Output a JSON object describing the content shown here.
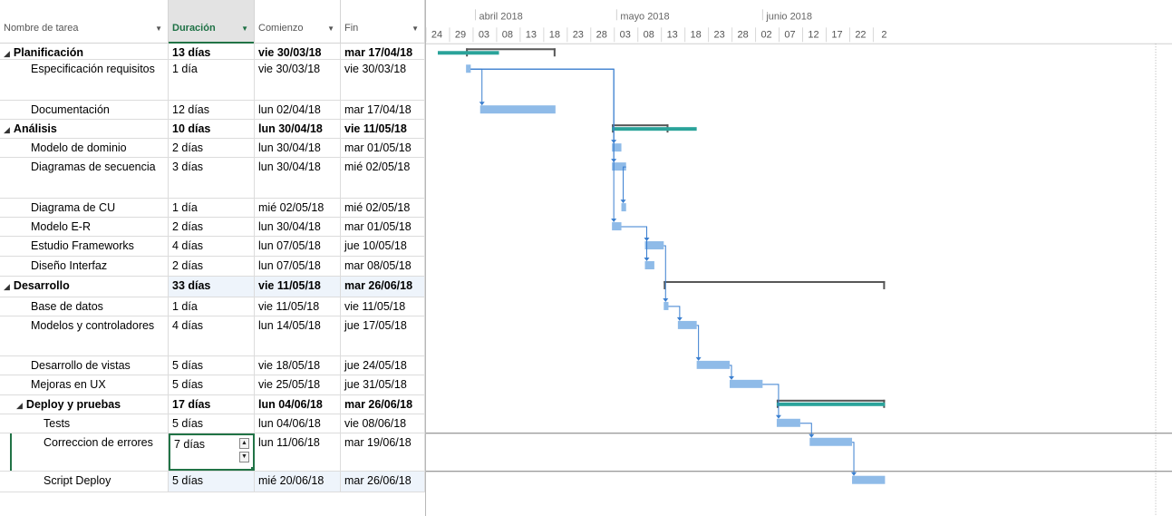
{
  "table": {
    "headers": {
      "name": "Nombre de tarea",
      "duration": "Duración",
      "start": "Comienzo",
      "end": "Fin"
    },
    "tasks": [
      {
        "name": "Planificación",
        "duration": "13 días",
        "start": "vie 30/03/18",
        "end": "mar 17/04/18",
        "summary": true,
        "level": 0
      },
      {
        "name": "Especificación requisitos",
        "duration": "1 día",
        "start": "vie 30/03/18",
        "end": "vie 30/03/18",
        "summary": false,
        "level": 1
      },
      {
        "name": "Documentación",
        "duration": "12 días",
        "start": "lun 02/04/18",
        "end": "mar 17/04/18",
        "summary": false,
        "level": 1
      },
      {
        "name": "Análisis",
        "duration": "10 días",
        "start": "lun 30/04/18",
        "end": "vie 11/05/18",
        "summary": true,
        "level": 0
      },
      {
        "name": "Modelo de dominio",
        "duration": "2 días",
        "start": "lun 30/04/18",
        "end": "mar 01/05/18",
        "summary": false,
        "level": 1
      },
      {
        "name": "Diagramas de secuencia",
        "duration": "3 días",
        "start": "lun 30/04/18",
        "end": "mié 02/05/18",
        "summary": false,
        "level": 1
      },
      {
        "name": "Diagrama de CU",
        "duration": "1 día",
        "start": "mié 02/05/18",
        "end": "mié 02/05/18",
        "summary": false,
        "level": 1
      },
      {
        "name": "Modelo E-R",
        "duration": "2 días",
        "start": "lun 30/04/18",
        "end": "mar 01/05/18",
        "summary": false,
        "level": 1
      },
      {
        "name": "Estudio Frameworks",
        "duration": "4 días",
        "start": "lun 07/05/18",
        "end": "jue 10/05/18",
        "summary": false,
        "level": 1
      },
      {
        "name": "Diseño Interfaz",
        "duration": "2 días",
        "start": "lun 07/05/18",
        "end": "mar 08/05/18",
        "summary": false,
        "level": 1
      },
      {
        "name": "Desarrollo",
        "duration": "33 días",
        "start": "vie 11/05/18",
        "end": "mar 26/06/18",
        "summary": true,
        "level": 0
      },
      {
        "name": "Base de datos",
        "duration": "1 día",
        "start": "vie 11/05/18",
        "end": "vie 11/05/18",
        "summary": false,
        "level": 1
      },
      {
        "name": " Modelos y controladores",
        "duration": "4 días",
        "start": "lun 14/05/18",
        "end": "jue 17/05/18",
        "summary": false,
        "level": 1
      },
      {
        "name": "Desarrollo de vistas",
        "duration": "5 días",
        "start": "vie 18/05/18",
        "end": "jue 24/05/18",
        "summary": false,
        "level": 1
      },
      {
        "name": "Mejoras en UX",
        "duration": "5 días",
        "start": "vie 25/05/18",
        "end": "jue 31/05/18",
        "summary": false,
        "level": 1
      },
      {
        "name": "Deploy y pruebas",
        "duration": "17 días",
        "start": "lun 04/06/18",
        "end": "mar 26/06/18",
        "summary": true,
        "level": 1
      },
      {
        "name": "Tests",
        "duration": "5 días",
        "start": "lun 04/06/18",
        "end": "vie 08/06/18",
        "summary": false,
        "level": 2
      },
      {
        "name": "Correccion de errores",
        "duration": "7 días",
        "start": "lun 11/06/18",
        "end": "mar 19/06/18",
        "summary": false,
        "level": 2
      },
      {
        "name": "Script Deploy",
        "duration": "5 días",
        "start": "mié 20/06/18",
        "end": "mar 26/06/18",
        "summary": false,
        "level": 2
      }
    ]
  },
  "timescale": {
    "months": [
      "abril 2018",
      "mayo 2018",
      "junio 2018"
    ],
    "days": [
      "24",
      "29",
      "03",
      "08",
      "13",
      "18",
      "23",
      "28",
      "03",
      "08",
      "13",
      "18",
      "23",
      "28",
      "02",
      "07",
      "12",
      "17",
      "22",
      "2"
    ]
  },
  "colors": {
    "summary_bar": "#2aa39a",
    "task_bar": "#8fbbe8",
    "link": "#3a7fd0",
    "bracket": "#555555",
    "selection": "#217346"
  }
}
